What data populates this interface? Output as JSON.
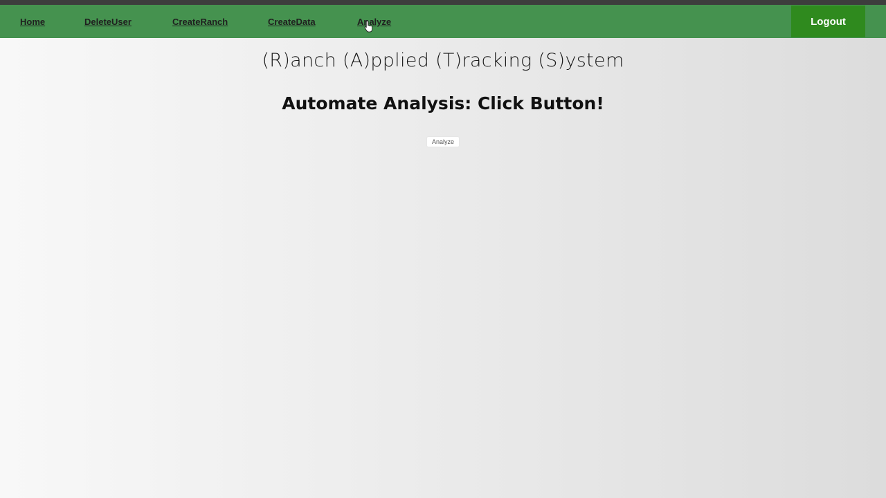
{
  "nav": {
    "links": [
      {
        "label": "Home"
      },
      {
        "label": "DeleteUser"
      },
      {
        "label": "CreateRanch"
      },
      {
        "label": "CreateData"
      },
      {
        "label": "Analyze"
      }
    ],
    "logout_label": "Logout",
    "background": "#45924f",
    "logout_color": "#2f8a1e"
  },
  "main": {
    "title": "(R)anch (A)pplied (T)racking (S)ystem",
    "subtitle": "Automate Analysis: Click Button!",
    "analyze_button_label": "Analyze"
  },
  "cursor": {
    "icon": "hand-pointer-icon"
  }
}
